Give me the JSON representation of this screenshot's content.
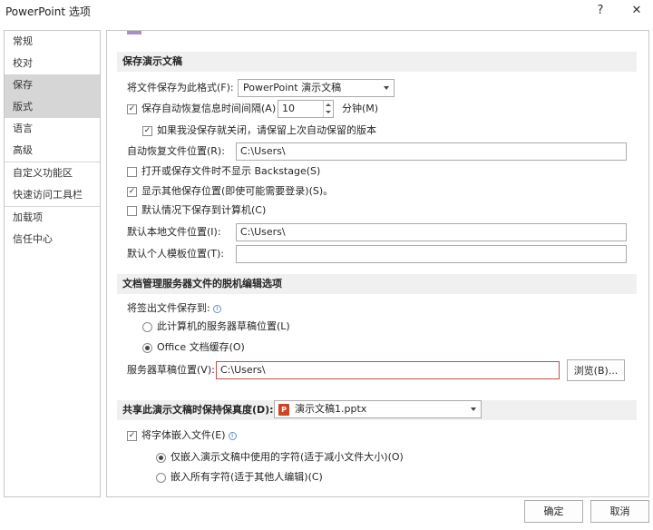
{
  "window": {
    "title": "PowerPoint 选项",
    "help_glyph": "?",
    "close_glyph": "✕"
  },
  "sidebar": {
    "items": [
      {
        "label": "常规"
      },
      {
        "label": "校对"
      },
      {
        "label": "保存"
      },
      {
        "label": "版式"
      },
      {
        "label": "语言"
      },
      {
        "label": "高级"
      },
      {
        "label": "自定义功能区"
      },
      {
        "label": "快速访问工具栏"
      },
      {
        "label": "加载项"
      },
      {
        "label": "信任中心"
      }
    ],
    "selected": "保存"
  },
  "save_section": {
    "header": "保存演示文稿",
    "format_label": "将文件保存为此格式(F):",
    "format_value": "PowerPoint 演示文稿",
    "autosave_label": "保存自动恢复信息时间间隔(A)",
    "autosave_checked": true,
    "autosave_minutes": "10",
    "minutes_label": "分钟(M)",
    "keep_last_label": "如果我没保存就关闭，请保留上次自动保留的版本",
    "keep_last_checked": true,
    "autorecover_location_label": "自动恢复文件位置(R):",
    "autorecover_location_value": "C:\\Users\\",
    "no_backstage_label": "打开或保存文件时不显示 Backstage(S)",
    "no_backstage_checked": false,
    "show_more_locations_label": "显示其他保存位置(即使可能需要登录)(S)。",
    "show_more_locations_checked": true,
    "save_to_computer_label": "默认情况下保存到计算机(C)",
    "save_to_computer_checked": false,
    "default_local_label": "默认本地文件位置(I):",
    "default_local_value": "C:\\Users\\",
    "template_location_label": "默认个人模板位置(T):",
    "template_location_value": ""
  },
  "offline_section": {
    "header": "文档管理服务器文件的脱机编辑选项",
    "save_checked_out_label": "将签出文件保存到:",
    "option_server": "此计算机的服务器草稿位置(L)",
    "option_cache": "Office 文档缓存(O)",
    "selected_option": "cache",
    "server_drafts_label": "服务器草稿位置(V):",
    "server_drafts_value": "C:\\Users\\",
    "browse_label": "浏览(B)..."
  },
  "fidelity_section": {
    "header": "共享此演示文稿时保持保真度(D):",
    "file_value": "演示文稿1.pptx",
    "embed_fonts_label": "将字体嵌入文件(E)",
    "embed_fonts_checked": true,
    "embed_used_label": "仅嵌入演示文稿中使用的字符(适于减小文件大小)(O)",
    "embed_all_label": "嵌入所有字符(适于其他人编辑)(C)",
    "embed_selected": "used"
  },
  "footer": {
    "ok_label": "确定",
    "cancel_label": "取消"
  },
  "colors": {
    "selected_nav": "#d6d6d6",
    "section_bg": "#f0f0f0",
    "error_border": "#c0504d"
  }
}
